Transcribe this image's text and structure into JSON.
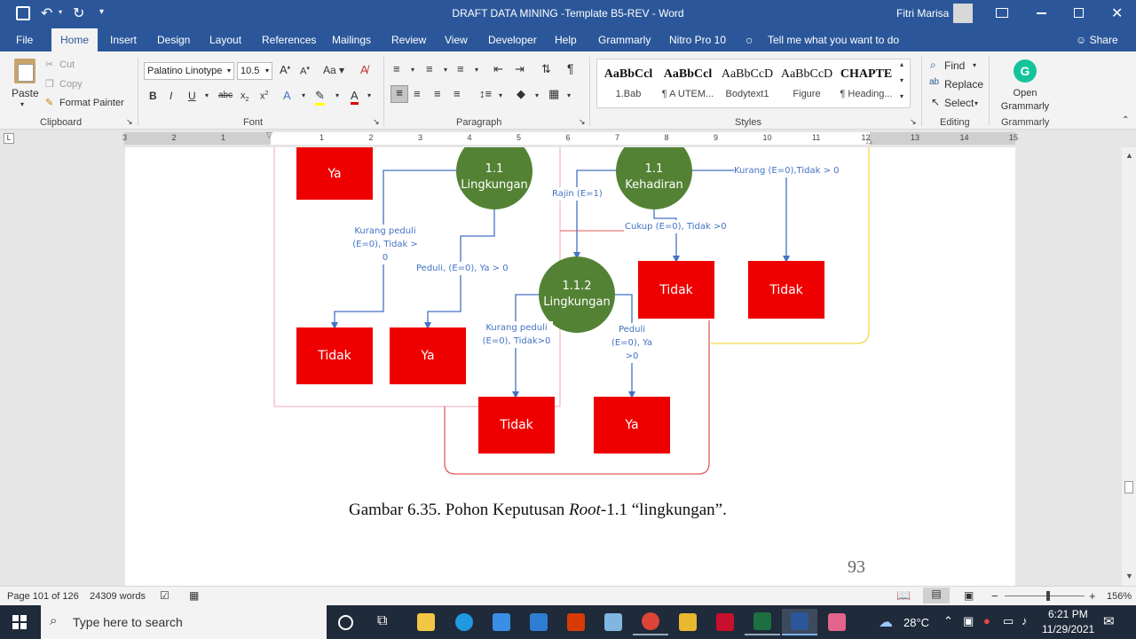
{
  "window": {
    "title": "DRAFT DATA MINING -Template B5-REV  -  Word",
    "user": "Fitri Marisa"
  },
  "menu": {
    "tabs": [
      "File",
      "Home",
      "Insert",
      "Design",
      "Layout",
      "References",
      "Mailings",
      "Review",
      "View",
      "Developer",
      "Help",
      "Grammarly",
      "Nitro Pro 10"
    ],
    "active": "Home",
    "tell_me": "Tell me what you want to do",
    "share": "Share"
  },
  "ribbon": {
    "clipboard": {
      "label": "Clipboard",
      "paste": "Paste",
      "cut": "Cut",
      "copy": "Copy",
      "format_painter": "Format Painter"
    },
    "font": {
      "label": "Font",
      "font_name": "Palatino Linotype",
      "font_size": "10.5"
    },
    "paragraph": {
      "label": "Paragraph"
    },
    "styles": {
      "label": "Styles",
      "items": [
        {
          "preview": "AaBbCcl",
          "name": "1.Bab"
        },
        {
          "preview": "AaBbCcl",
          "name": "¶ A UTEM..."
        },
        {
          "preview": "AaBbCcD",
          "name": "Bodytext1"
        },
        {
          "preview": "AaBbCcD",
          "name": "Figure"
        },
        {
          "preview": "CHAPTE",
          "name": "¶ Heading..."
        }
      ]
    },
    "editing": {
      "label": "Editing",
      "find": "Find",
      "replace": "Replace",
      "select": "Select"
    },
    "grammarly": {
      "label": "Grammarly",
      "open": "Open Grammarly"
    }
  },
  "ruler": {
    "numbers": [
      "3",
      "2",
      "1",
      "1",
      "2",
      "3",
      "4",
      "5",
      "6",
      "7",
      "8",
      "9",
      "10",
      "11",
      "12",
      "13",
      "14",
      "15"
    ]
  },
  "diagram": {
    "nodes": {
      "ya_top": "Ya",
      "n11_lingkungan": {
        "num": "1.1",
        "name": "Lingkungan"
      },
      "n11_kehadiran": {
        "num": "1.1",
        "name": "Kehadiran"
      },
      "n112_lingkungan": {
        "num": "1.1.2",
        "name": "Lingkungan"
      },
      "tidak_a": "Tidak",
      "ya_a": "Ya",
      "tidak_b": "Tidak",
      "tidak_c": "Tidak",
      "tidak_d": "Tidak",
      "ya_b": "Ya"
    },
    "edges": {
      "kurang_peduli_1": "Kurang peduli (E=0), Tidak > 0",
      "peduli_1": "Peduli, (E=0), Ya > 0",
      "rajin": "Rajin (E=1)",
      "cukup": "Cukup (E=0), Tidak >0",
      "kurang_kehadiran": "Kurang (E=0),Tidak > 0",
      "kurang_peduli_2": "Kurang peduli (E=0), Tidak>0",
      "peduli_2": "Peduli (E=0), Ya >0"
    },
    "caption_prefix": "Gambar 6.35. Pohon Keputusan ",
    "caption_italic": "Root",
    "caption_suffix": "-1.1 “lingkungan”.",
    "page_number": "93"
  },
  "status": {
    "page": "Page 101 of 126",
    "words": "24309 words",
    "zoom": "156%"
  },
  "taskbar": {
    "search_placeholder": "Type here to search",
    "temperature": "28°C",
    "time": "6:21 PM",
    "date": "11/29/2021"
  },
  "colors": {
    "word_blue": "#2b579a",
    "node_red": "#ee0000",
    "node_green": "#548235",
    "edge_blue": "#4472c4"
  }
}
